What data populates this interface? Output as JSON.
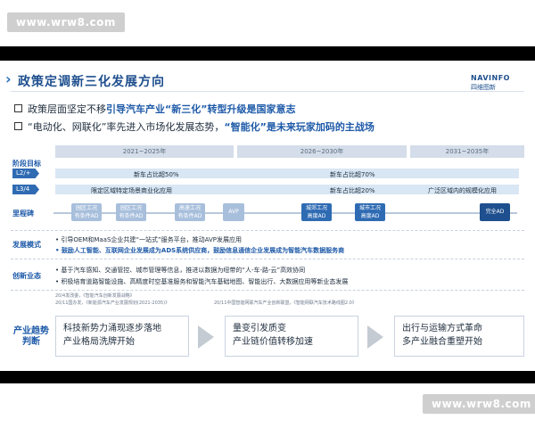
{
  "watermark": {
    "top": "www.wrw8.com",
    "bottom": "www.wrw8.com"
  },
  "slide": {
    "title": "政策定调新三化发展方向",
    "logo": {
      "en": "NAVINFO",
      "cn": "四维图新"
    },
    "bullets": [
      {
        "pre": "政策层面坚定不移",
        "hl": "引导汽车产业“新三化”转型升级是国家意志",
        "post": ""
      },
      {
        "pre": "“电动化、网联化”率先进入市场化发展态势，",
        "hl": "“智能化”是未来玩家加码的主战场",
        "post": ""
      }
    ],
    "periods": [
      "2021~2025年",
      "2026~2030年",
      "2031~2035年"
    ],
    "stage_label": "阶段目标",
    "levels": [
      {
        "tag": "L2/+",
        "segments": [
          "新车占比超50%",
          "新车占比超70%"
        ]
      },
      {
        "tag": "L3/4",
        "segments": [
          "限定区域特定场景商业化应用",
          "新车占比超20%",
          "广泛区域内的规模化应用"
        ]
      }
    ],
    "milestone_label": "里程碑",
    "milestones": [
      {
        "line1": "园区工况",
        "line2": "有条件AD",
        "style": "light"
      },
      {
        "line1": "园区工况",
        "line2": "有条件AD",
        "style": "light"
      },
      {
        "line1": "高速工况",
        "line2": "有条件AD",
        "style": "light"
      },
      {
        "line1": "AVP",
        "line2": "",
        "style": "light"
      },
      {
        "line1": "城郊工况",
        "line2": "高度AD",
        "style": "dark"
      },
      {
        "line1": "城市工况",
        "line2": "高度AD",
        "style": "dark"
      },
      {
        "line1": "完全AD",
        "line2": "",
        "style": "solid"
      }
    ],
    "dev_mode_label": "发展模式",
    "dev_mode_lines": [
      "• 引导OEM和MaaS企业共建“一站式”服务平台，推动AVP发展应用",
      "• 鼓励人工智能、互联网企业发展成为ADS系统供应商，鼓励信息通信企业发展成为智能汽车数据服务商"
    ],
    "innov_label": "创新业态",
    "innov_lines": [
      "• 基于汽车感知、交通管控、城市管理等信息，推进以数据为纽带的“人-车-路-云”高效协同",
      "• 积极培育道路智能设施、高精度时空基准服务和智能汽车基础地图、智能出行、大数据应用等新业态发展"
    ],
    "notes": [
      "20/4发改委，《智能汽车创新发展战略》",
      "20/11国办发，《新能源汽车产业发展规划(2021-2035)》",
      "20/11中国智能网联汽车产业创新联盟，《智能网联汽车技术路线图2.0》"
    ],
    "trend_label": "产业趋势判断",
    "trends": [
      {
        "line1": "科技新势力涌现逐步落地",
        "line2": "产业格局洗牌开始"
      },
      {
        "line1": "量变引发质变",
        "line2": "产业链价值转移加速"
      },
      {
        "line1": "出行与运输方式革命",
        "line2": "多产业融合重塑开始"
      }
    ]
  }
}
